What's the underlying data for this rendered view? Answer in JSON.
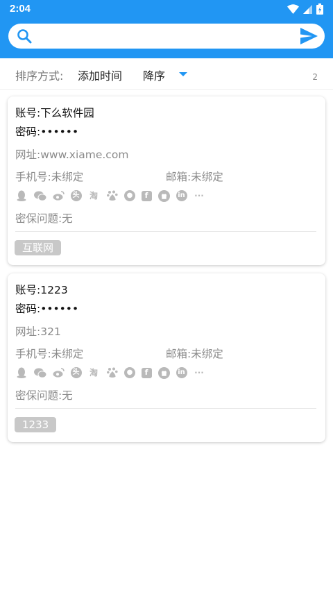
{
  "status_bar": {
    "time": "2:04"
  },
  "search": {
    "placeholder": "",
    "value": ""
  },
  "sort": {
    "label": "排序方式:",
    "field": "添加时间",
    "order": "降序",
    "count": "2"
  },
  "colors": {
    "primary": "#2196f3",
    "muted": "#8a8a8a",
    "tag_bg": "#c8c8c8"
  },
  "social_icons": [
    "qq-icon",
    "wechat-icon",
    "weibo-icon",
    "toutiao-icon",
    "taobao-icon",
    "baidu-icon",
    "other-icon",
    "facebook-icon",
    "github-icon",
    "linkedin-icon",
    "more-icon"
  ],
  "cards": [
    {
      "account_label": "账号:",
      "account": "下么软件园",
      "password_label": "密码:",
      "password": "••••••",
      "url_label": "网址:",
      "url": "www.xiame.com",
      "phone_label": "手机号:",
      "phone": "未绑定",
      "email_label": "邮箱:",
      "email": "未绑定",
      "security_label": "密保问题:",
      "security": "无",
      "tag": "互联网"
    },
    {
      "account_label": "账号:",
      "account": "1223",
      "password_label": "密码:",
      "password": "••••••",
      "url_label": "网址:",
      "url": "321",
      "phone_label": "手机号:",
      "phone": "未绑定",
      "email_label": "邮箱:",
      "email": "未绑定",
      "security_label": "密保问题:",
      "security": "无",
      "tag": "1233"
    }
  ]
}
